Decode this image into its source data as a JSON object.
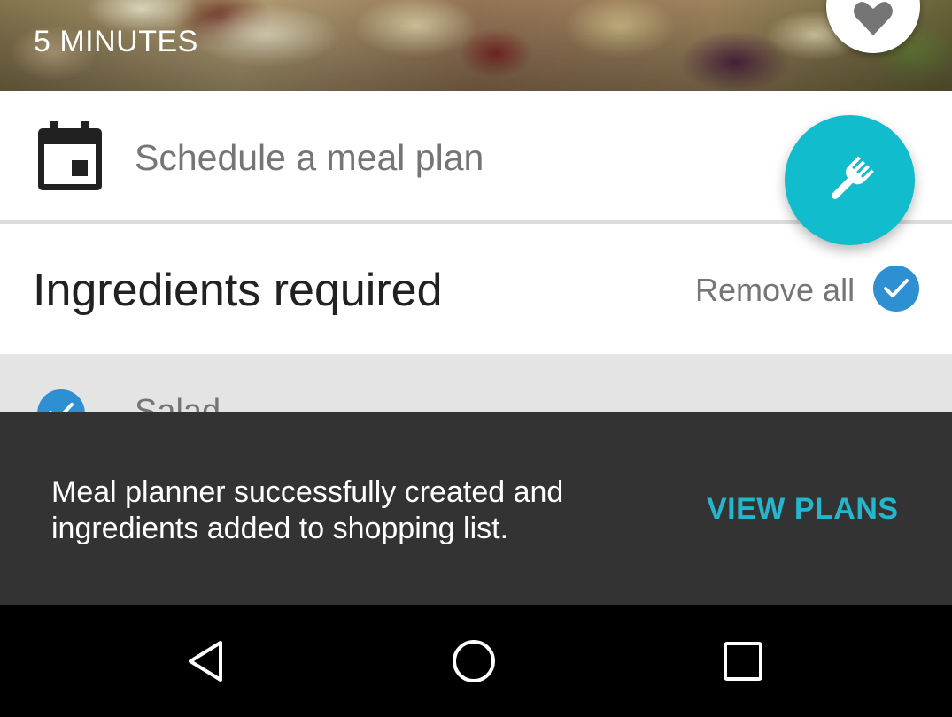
{
  "hero": {
    "time_label": "5 MINUTES"
  },
  "schedule": {
    "label": "Schedule a meal plan"
  },
  "ingredients": {
    "title": "Ingredients required",
    "remove_all": "Remove all"
  },
  "list": {
    "items": [
      {
        "label": "Salad",
        "checked": true
      }
    ]
  },
  "snackbar": {
    "message": "Meal planner successfully created and ingredients added to shopping list.",
    "action": "VIEW PLANS"
  },
  "colors": {
    "accent": "#11bccd",
    "check": "#2e8fd3",
    "snackbar": "#333333",
    "action": "#24b6cc"
  },
  "icons": [
    "heart-icon",
    "calendar-icon",
    "fork-icon",
    "check-icon",
    "back-icon",
    "home-icon",
    "recents-icon"
  ]
}
